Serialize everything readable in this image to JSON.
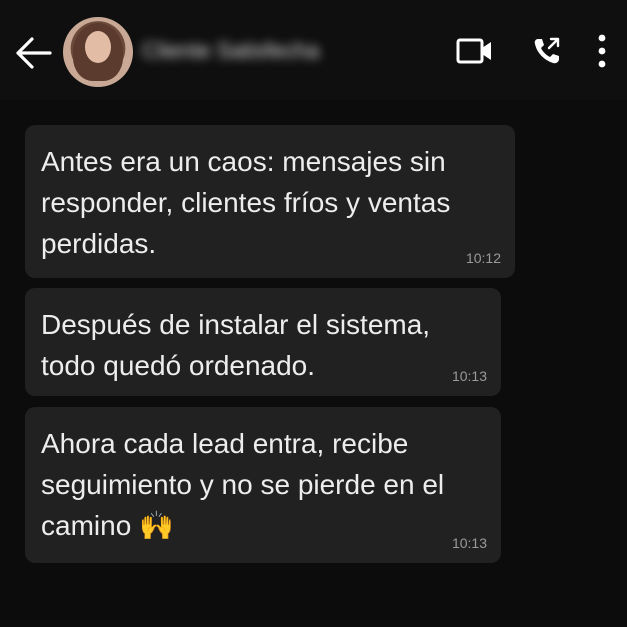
{
  "header": {
    "back_icon": "arrow-left-icon",
    "contact_name": "Cliente Satisfecha",
    "actions": [
      {
        "name": "video-call",
        "icon": "video-camera-icon"
      },
      {
        "name": "voice-call",
        "icon": "phone-call-icon"
      },
      {
        "name": "menu",
        "icon": "more-vertical-icon"
      }
    ]
  },
  "messages": [
    {
      "text": "Antes era un caos: mensajes sin responder, clientes fríos y ventas perdidas.",
      "time": "10:12"
    },
    {
      "text": "Después de instalar el sistema, todo quedó ordenado.",
      "time": "10:13"
    },
    {
      "text": "Ahora cada lead entra, recibe seguimiento y no se pierde en el camino 🙌",
      "time": "10:13"
    }
  ],
  "colors": {
    "background": "#0d0d0d",
    "bubble": "#212121",
    "text": "#ededed",
    "timestamp": "#9a9a9a",
    "icons": "#ffffff"
  }
}
